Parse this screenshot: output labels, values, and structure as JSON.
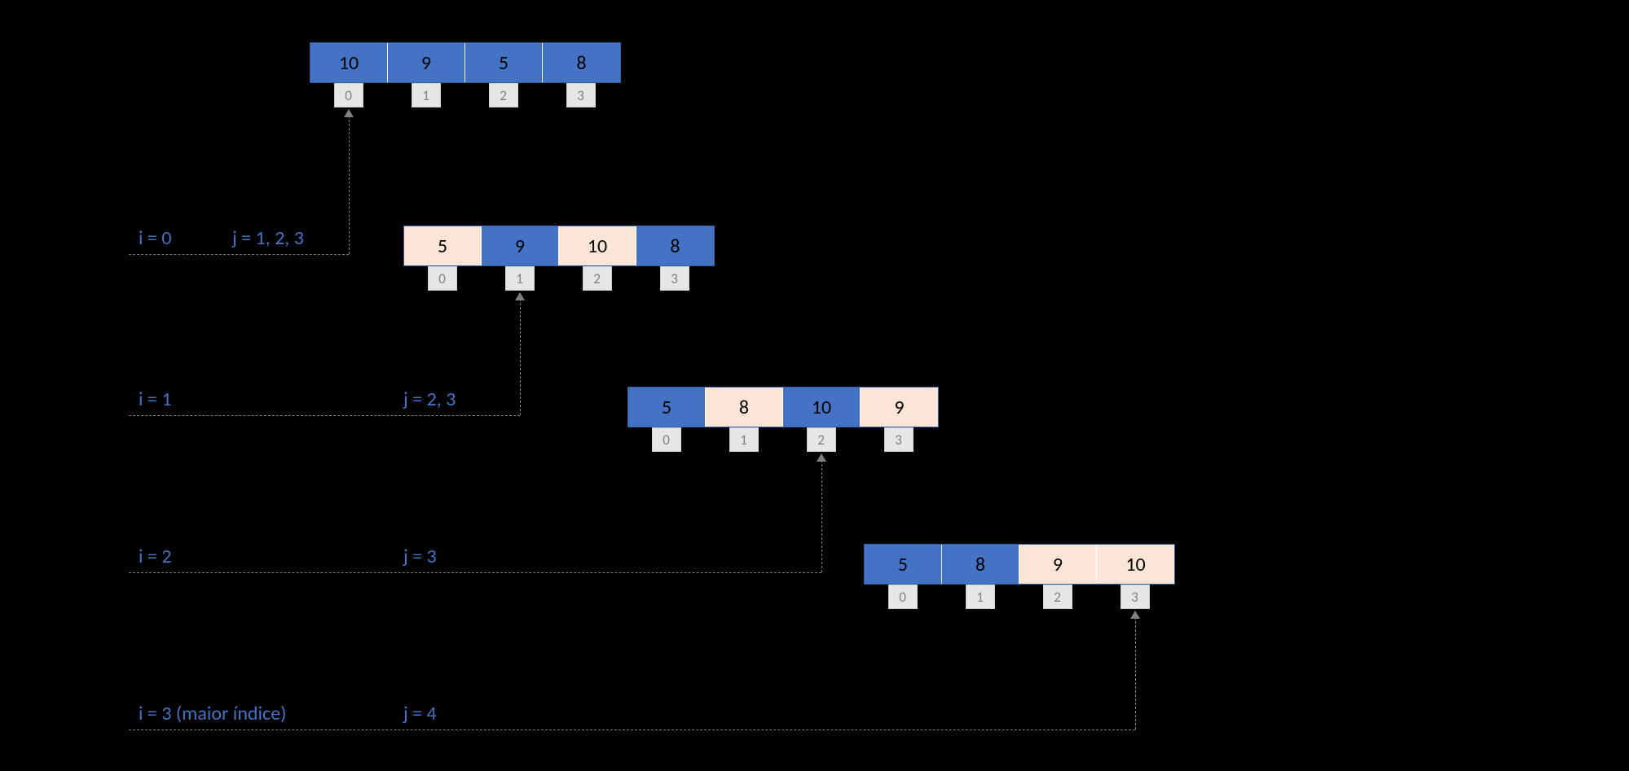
{
  "chart_data": {
    "type": "table",
    "description": "Selection sort iteration trace",
    "arrays": [
      {
        "values": [
          10,
          9,
          5,
          8
        ],
        "colors": [
          "blue",
          "blue",
          "blue",
          "blue"
        ],
        "indices": [
          0,
          1,
          2,
          3
        ],
        "pointer_index": 0
      },
      {
        "values": [
          5,
          9,
          10,
          8
        ],
        "colors": [
          "peach",
          "blue",
          "peach",
          "blue"
        ],
        "indices": [
          0,
          1,
          2,
          3
        ],
        "pointer_index": 1
      },
      {
        "values": [
          5,
          8,
          10,
          9
        ],
        "colors": [
          "blue",
          "peach",
          "blue",
          "peach"
        ],
        "indices": [
          0,
          1,
          2,
          3
        ],
        "pointer_index": 2
      },
      {
        "values": [
          5,
          8,
          9,
          10
        ],
        "colors": [
          "blue",
          "blue",
          "peach",
          "peach"
        ],
        "indices": [
          0,
          1,
          2,
          3
        ],
        "pointer_index": 3
      }
    ],
    "steps": [
      {
        "i_label": "i = 0",
        "j_label": "j = 1, 2, 3"
      },
      {
        "i_label": "i = 1",
        "j_label": "j = 2, 3"
      },
      {
        "i_label": "i = 2",
        "j_label": "j = 3"
      },
      {
        "i_label": "i = 3 (maior índice)",
        "j_label": "j = 4"
      }
    ]
  },
  "labels": {
    "i0": "i = 0",
    "j0": "j = 1, 2, 3",
    "i1": "i = 1",
    "j1": "j = 2, 3",
    "i2": "i = 2",
    "j2": "j = 3",
    "i3": "i = 3 (maior índice)",
    "j3": "j = 4"
  },
  "arrays": {
    "a0": {
      "v0": "10",
      "v1": "9",
      "v2": "5",
      "v3": "8",
      "i0": "0",
      "i1": "1",
      "i2": "2",
      "i3": "3"
    },
    "a1": {
      "v0": "5",
      "v1": "9",
      "v2": "10",
      "v3": "8",
      "i0": "0",
      "i1": "1",
      "i2": "2",
      "i3": "3"
    },
    "a2": {
      "v0": "5",
      "v1": "8",
      "v2": "10",
      "v3": "9",
      "i0": "0",
      "i1": "1",
      "i2": "2",
      "i3": "3"
    },
    "a3": {
      "v0": "5",
      "v1": "8",
      "v2": "9",
      "v3": "10",
      "i0": "0",
      "i1": "1",
      "i2": "2",
      "i3": "3"
    }
  }
}
